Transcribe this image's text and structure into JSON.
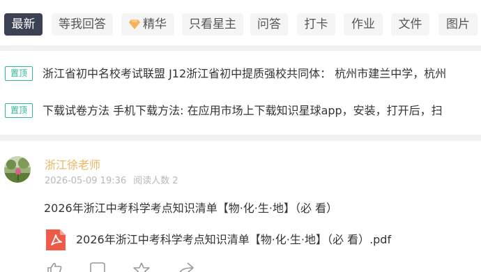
{
  "tabs": [
    {
      "label": "最新",
      "active": true
    },
    {
      "label": "等我回答",
      "active": false
    },
    {
      "label": "精华",
      "active": false,
      "icon": "diamond-icon"
    },
    {
      "label": "只看星主",
      "active": false
    },
    {
      "label": "问答",
      "active": false
    },
    {
      "label": "打卡",
      "active": false
    },
    {
      "label": "作业",
      "active": false
    },
    {
      "label": "文件",
      "active": false
    },
    {
      "label": "图片",
      "active": false
    }
  ],
  "pinned": {
    "badge": "置顶",
    "items": [
      {
        "text": "浙江省初中名校考试联盟 J12浙江省初中提质强校共同体： 杭州市建兰中学，杭州"
      },
      {
        "text": "下载试卷方法 手机下载方法: 在应用市场上下载知识星球app，安装，打开后，扫"
      }
    ]
  },
  "post": {
    "author": "浙江徐老师",
    "date": "2026-05-09 19:36",
    "readers": "阅读人数 2",
    "title": "2026年浙江中考科学考点知识清单【物·化·生·地】（必 看）",
    "attachment": {
      "name": "2026年浙江中考科学考点知识清单【物·化·生·地】（必 看）.pdf",
      "icon": "pdf-file-icon"
    },
    "actions": [
      "like-icon",
      "comment-icon",
      "star-icon",
      "share-icon"
    ]
  },
  "colors": {
    "tab_active_bg": "#3c4154",
    "tab_bg": "#f5f5f5",
    "pin_green": "#2db79a",
    "author_gold": "#e8b862",
    "pdf_red": "#ef5b4b"
  }
}
